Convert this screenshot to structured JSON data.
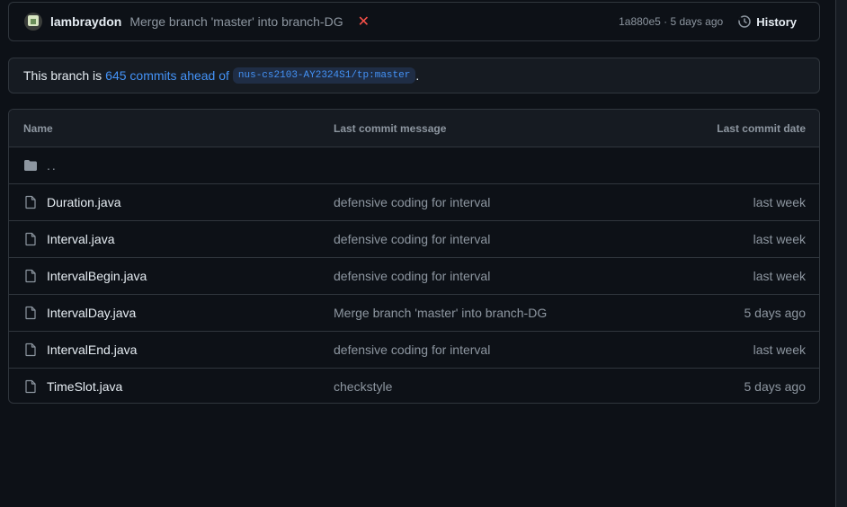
{
  "commit_bar": {
    "author": "lambraydon",
    "message": "Merge branch 'master' into branch-DG",
    "status_icon": "x-icon",
    "status_glyph": "✕",
    "meta": "1a880e5 · 5 days ago",
    "history_label": "History"
  },
  "ahead": {
    "prefix": "This branch is",
    "link": "645 commits ahead of",
    "branch": "nus-cs2103-AY2324S1/tp:master",
    "suffix": "."
  },
  "table": {
    "headers": {
      "name": "Name",
      "message": "Last commit message",
      "date": "Last commit date"
    },
    "parent": "..",
    "rows": [
      {
        "name": "Duration.java",
        "message": "defensive coding for interval",
        "date": "last week"
      },
      {
        "name": "Interval.java",
        "message": "defensive coding for interval",
        "date": "last week"
      },
      {
        "name": "IntervalBegin.java",
        "message": "defensive coding for interval",
        "date": "last week"
      },
      {
        "name": "IntervalDay.java",
        "message": "Merge branch 'master' into branch-DG",
        "date": "5 days ago"
      },
      {
        "name": "IntervalEnd.java",
        "message": "defensive coding for interval",
        "date": "last week"
      },
      {
        "name": "TimeSlot.java",
        "message": "checkstyle",
        "date": "5 days ago"
      }
    ]
  },
  "colors": {
    "bg": "#0d1117",
    "border": "#30363d",
    "link": "#4493f8",
    "error": "#f85149"
  }
}
